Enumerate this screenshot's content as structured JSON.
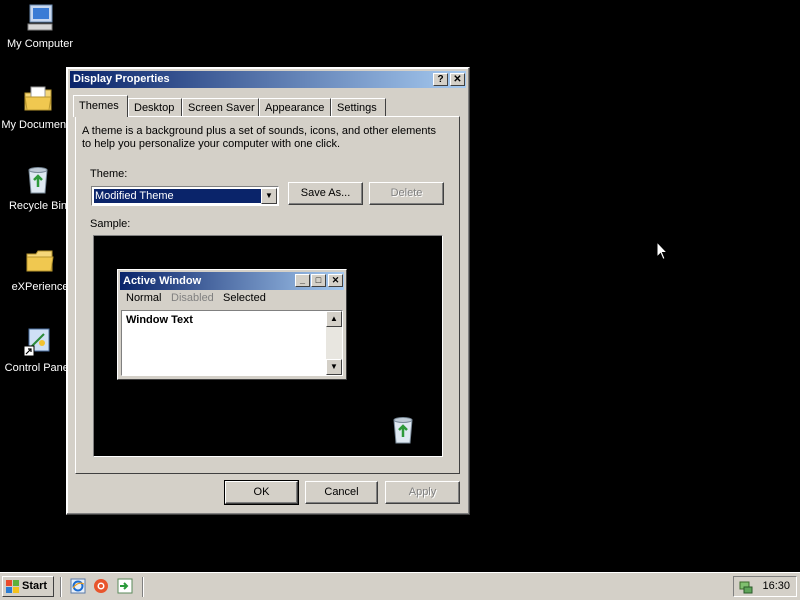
{
  "desktop": {
    "icons": [
      {
        "label": "My Computer",
        "icon": "my-computer-icon"
      },
      {
        "label": "My Documents",
        "icon": "my-documents-icon"
      },
      {
        "label": "Recycle Bin",
        "icon": "recycle-bin-icon"
      },
      {
        "label": "eXPerience",
        "icon": "folder-icon"
      },
      {
        "label": "Control Panel",
        "icon": "control-panel-shortcut-icon"
      }
    ]
  },
  "dialog": {
    "title": "Display Properties",
    "help_button": "?",
    "close_button": "✕",
    "tabs": [
      "Themes",
      "Desktop",
      "Screen Saver",
      "Appearance",
      "Settings"
    ],
    "active_tab": "Themes",
    "description": "A theme is a background plus a set of sounds, icons, and other elements to help you personalize your computer with one click.",
    "theme_label": "Theme:",
    "theme_value": "Modified Theme",
    "save_as_label": "Save As...",
    "delete_label": "Delete",
    "sample_label": "Sample:",
    "sample": {
      "window_title": "Active Window",
      "menu": [
        "Normal",
        "Disabled",
        "Selected"
      ],
      "window_text": "Window Text"
    },
    "ok_label": "OK",
    "cancel_label": "Cancel",
    "apply_label": "Apply"
  },
  "taskbar": {
    "start_label": "Start",
    "quick_launch": [
      "internet-explorer-icon",
      "browser-icon",
      "exit-icon"
    ],
    "clock": "16:30"
  },
  "colors": {
    "desktop": "#000000",
    "face": "#d4d0c8",
    "title_active_start": "#0a246a",
    "title_active_end": "#a6caf0"
  }
}
